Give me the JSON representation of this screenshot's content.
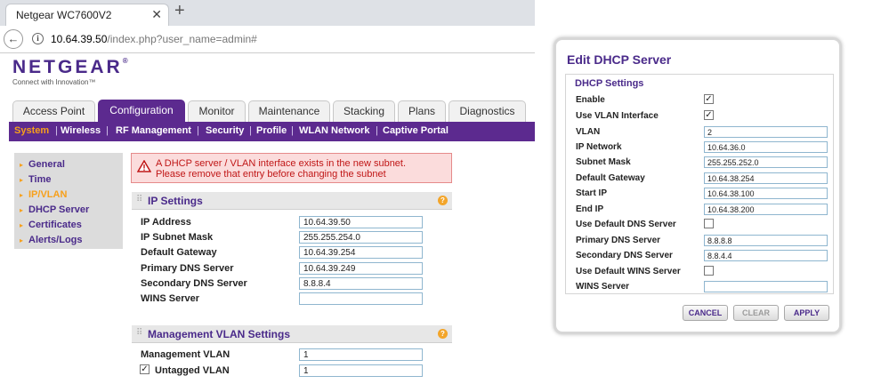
{
  "browser": {
    "tab_title": "Netgear WC7600V2",
    "tab_close": "✕",
    "new_tab": "+",
    "url_host": "10.64.39.50",
    "url_path": "/index.php?user_name=admin#"
  },
  "brand": {
    "logo": "NETGEAR",
    "logo_mark": "®",
    "tagline": "Connect with Innovation™"
  },
  "main_tabs": [
    {
      "label": "Access Point",
      "active": false
    },
    {
      "label": "Configuration",
      "active": true
    },
    {
      "label": "Monitor",
      "active": false
    },
    {
      "label": "Maintenance",
      "active": false
    },
    {
      "label": "Stacking",
      "active": false
    },
    {
      "label": "Plans",
      "active": false
    },
    {
      "label": "Diagnostics",
      "active": false
    }
  ],
  "sub_tabs": [
    {
      "label": "System",
      "active": true
    },
    {
      "label": "Wireless",
      "active": false
    },
    {
      "label": "RF Management",
      "active": false
    },
    {
      "label": "Security",
      "active": false
    },
    {
      "label": "Profile",
      "active": false
    },
    {
      "label": "WLAN Network",
      "active": false
    },
    {
      "label": "Captive Portal",
      "active": false
    }
  ],
  "left_nav": [
    {
      "label": "General",
      "active": false
    },
    {
      "label": "Time",
      "active": false
    },
    {
      "label": "IP/VLAN",
      "active": true
    },
    {
      "label": "DHCP Server",
      "active": false
    },
    {
      "label": "Certificates",
      "active": false
    },
    {
      "label": "Alerts/Logs",
      "active": false
    }
  ],
  "alert": {
    "line1": "A DHCP server / VLAN interface exists in the new subnet.",
    "line2": "Please remove that entry before changing the subnet"
  },
  "ip_settings": {
    "title": "IP Settings",
    "rows": [
      {
        "label": "IP Address",
        "value": "10.64.39.50"
      },
      {
        "label": "IP Subnet Mask",
        "value": "255.255.254.0"
      },
      {
        "label": "Default Gateway",
        "value": "10.64.39.254"
      },
      {
        "label": "Primary DNS Server",
        "value": "10.64.39.249"
      },
      {
        "label": "Secondary DNS Server",
        "value": "8.8.8.4"
      },
      {
        "label": "WINS Server",
        "value": ""
      }
    ]
  },
  "mgmt_vlan": {
    "title": "Management VLAN Settings",
    "vlan_label": "Management VLAN",
    "vlan_value": "1",
    "untagged_label": "Untagged VLAN",
    "untagged_checked": true,
    "untagged_value": "1"
  },
  "dialog": {
    "title": "Edit DHCP Server",
    "section": "DHCP Settings",
    "enable_label": "Enable",
    "enable_checked": true,
    "use_vlan_label": "Use VLAN Interface",
    "use_vlan_checked": true,
    "fields": [
      {
        "label": "VLAN",
        "value": "2"
      },
      {
        "label": "IP Network",
        "value": "10.64.36.0"
      },
      {
        "label": "Subnet Mask",
        "value": "255.255.252.0"
      },
      {
        "label": "Default Gateway",
        "value": "10.64.38.254"
      },
      {
        "label": "Start IP",
        "value": "10.64.38.100"
      },
      {
        "label": "End IP",
        "value": "10.64.38.200"
      }
    ],
    "use_default_dns_label": "Use Default DNS Server",
    "use_default_dns_checked": false,
    "dns_fields": [
      {
        "label": "Primary DNS Server",
        "value": "8.8.8.8"
      },
      {
        "label": "Secondary DNS Server",
        "value": "8.8.4.4"
      }
    ],
    "use_default_wins_label": "Use Default WINS Server",
    "use_default_wins_checked": false,
    "wins_label": "WINS Server",
    "wins_value": "",
    "buttons": {
      "cancel": "CANCEL",
      "clear": "CLEAR",
      "apply": "APPLY"
    }
  },
  "check_mark": "✓",
  "icons": {
    "back": "arrow-left-icon",
    "info": "info-icon",
    "warning": "warning-triangle-icon",
    "help": "help-icon"
  },
  "colors": {
    "brand_purple": "#5c2a8f",
    "accent_orange": "#f7a01b",
    "alert_red": "#c01616"
  }
}
